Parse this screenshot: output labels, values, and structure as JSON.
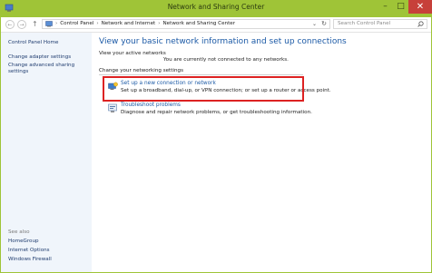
{
  "window": {
    "title": "Network and Sharing Center",
    "controls": {
      "minimize": "–",
      "maximize": "□",
      "close": "✕"
    },
    "accent_color": "#9fc437"
  },
  "address_bar": {
    "back": "←",
    "forward": "→",
    "up": "↑",
    "breadcrumbs": [
      "Control Panel",
      "Network and Internet",
      "Network and Sharing Center"
    ],
    "separator": "›",
    "dropdown": "⌄",
    "refresh": "↻",
    "search_placeholder": "Search Control Panel"
  },
  "sidebar": {
    "links": [
      "Control Panel Home",
      "Change adapter settings",
      "Change advanced sharing",
      "settings"
    ],
    "see_also_label": "See also",
    "see_also": [
      "HomeGroup",
      "Internet Options",
      "Windows Firewall"
    ]
  },
  "main": {
    "heading": "View your basic network information and set up connections",
    "active_networks_label": "View your active networks",
    "active_networks_status": "You are currently not connected to any networks.",
    "change_settings_label": "Change your networking settings",
    "tasks": [
      {
        "icon": "new-connection-icon",
        "link": "Set up a new connection or network",
        "desc": "Set up a broadband, dial-up, or VPN connection; or set up a router or access point."
      },
      {
        "icon": "troubleshoot-icon",
        "link": "Troubleshoot problems",
        "desc": "Diagnose and repair network problems, or get troubleshooting information."
      }
    ]
  },
  "highlight_color": "#dd2222"
}
